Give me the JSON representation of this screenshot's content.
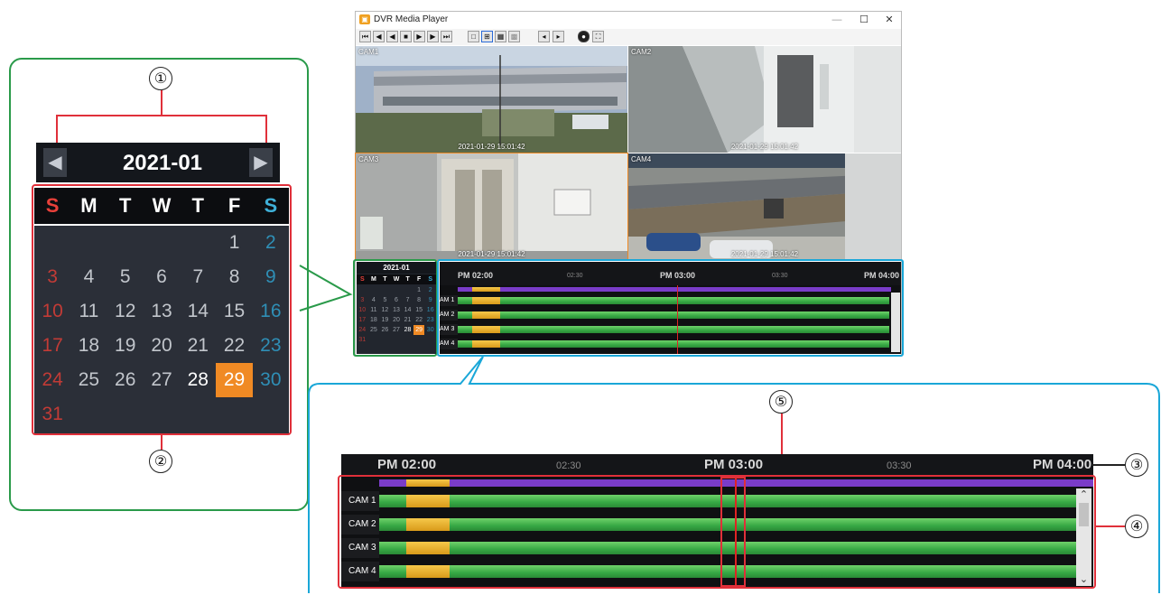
{
  "callouts": {
    "n1": "①",
    "n2": "②",
    "n3": "③",
    "n4": "④",
    "n5": "⑤"
  },
  "calendar": {
    "title": "2021-01",
    "prev_icon": "◀",
    "next_icon": "▶",
    "dow": [
      "S",
      "M",
      "T",
      "W",
      "T",
      "F",
      "S"
    ],
    "days": [
      "",
      "",
      "",
      "",
      "",
      "1",
      "2",
      "3",
      "4",
      "5",
      "6",
      "7",
      "8",
      "9",
      "10",
      "11",
      "12",
      "13",
      "14",
      "15",
      "16",
      "17",
      "18",
      "19",
      "20",
      "21",
      "22",
      "23",
      "24",
      "25",
      "26",
      "27",
      "28",
      "29",
      "30",
      "31"
    ],
    "selected": "29"
  },
  "window": {
    "title": "DVR Media Player",
    "minimize": "—",
    "maximize": "☐",
    "close": "✕",
    "toolbar": [
      "⏮",
      "◀",
      "◀",
      "■",
      "▶",
      "▶",
      "⏭",
      "□",
      "⊞",
      "▦",
      "▩",
      "◂",
      "▸",
      "●",
      "⛶"
    ]
  },
  "cameras": [
    {
      "label": "CAM1",
      "timestamp": "2021-01-29 15:01:42"
    },
    {
      "label": "CAM2",
      "timestamp": "2021-01-29 15:01:42"
    },
    {
      "label": "CAM3",
      "timestamp": "2021-01-29 15:01:42"
    },
    {
      "label": "CAM4",
      "timestamp": "2021-01-29 15:01:42"
    }
  ],
  "timeline": {
    "ticks": [
      {
        "label": "PM 02:00",
        "major": true
      },
      {
        "label": "02:30",
        "major": false
      },
      {
        "label": "PM 03:00",
        "major": true
      },
      {
        "label": "03:30",
        "major": false
      },
      {
        "label": "PM 04:00",
        "major": true
      }
    ],
    "small_ticks": [
      "PM 02:00",
      "02:30",
      "PM 03:00",
      "03:30",
      "PM 04:00"
    ],
    "rows": [
      "CAM 1",
      "CAM 2",
      "CAM 3",
      "CAM 4"
    ],
    "small_rows": [
      "AM 1",
      "AM 2",
      "AM 3",
      "AM 4"
    ],
    "scroll_up": "⌃",
    "scroll_down": "⌄"
  },
  "colors": {
    "record": "#36a844",
    "event": "#e0a62a",
    "overview": "#7a3cc8",
    "cursor": "#e02424",
    "selected_day": "#f08a24",
    "sunday": "#e8403a",
    "saturday": "#3fb0d8"
  }
}
